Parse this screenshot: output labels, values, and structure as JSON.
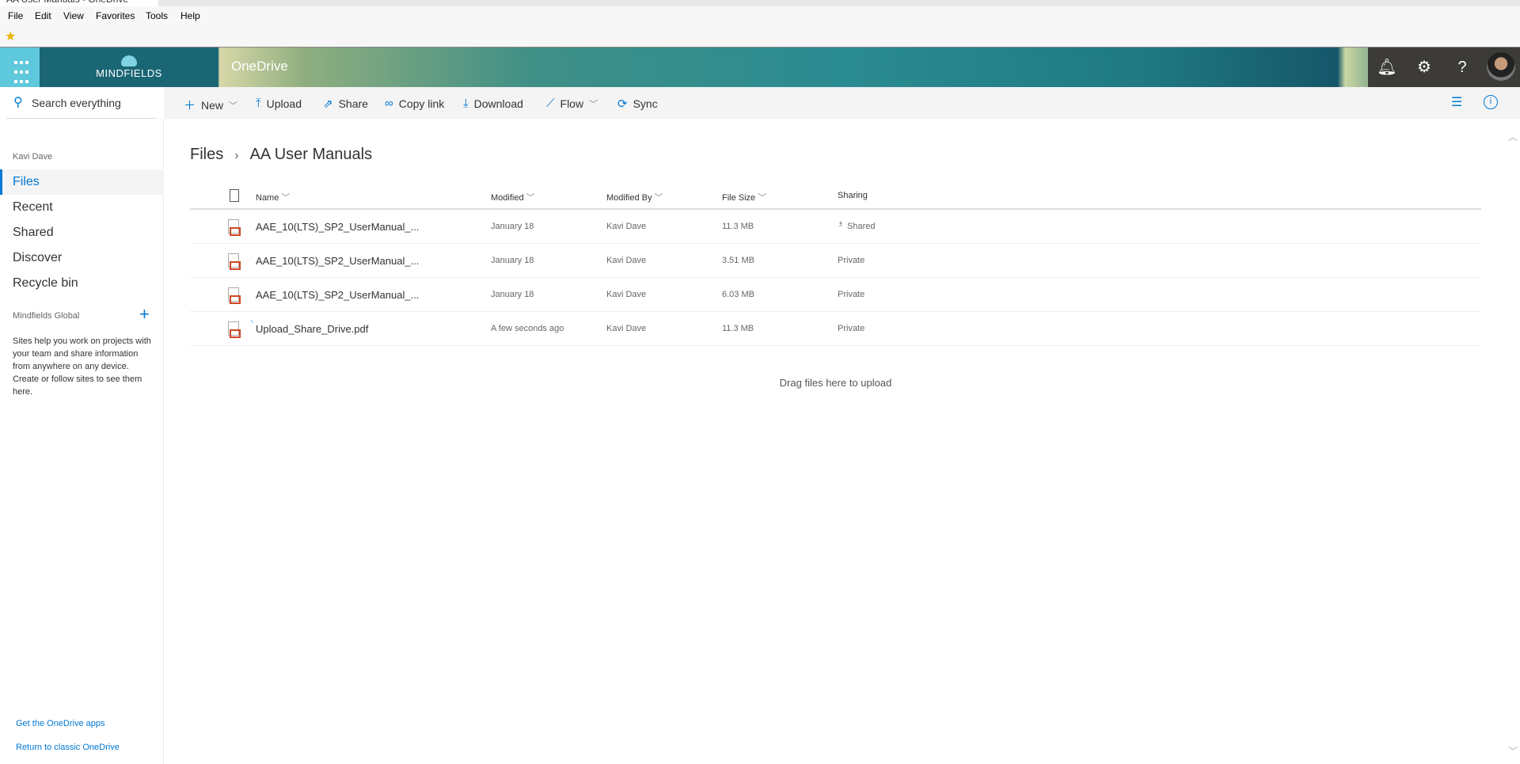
{
  "browser": {
    "tab_title": "AA User Manuals - OneDrive",
    "menu": [
      "File",
      "Edit",
      "View",
      "Favorites",
      "Tools",
      "Help"
    ]
  },
  "header": {
    "logo_text": "MINDFIELDS",
    "app_name": "OneDrive"
  },
  "search": {
    "placeholder": "Search everything"
  },
  "commands": {
    "new": "New",
    "upload": "Upload",
    "share": "Share",
    "copy_link": "Copy link",
    "download": "Download",
    "flow": "Flow",
    "sync": "Sync"
  },
  "nav": {
    "user": "Kavi Dave",
    "items": [
      "Files",
      "Recent",
      "Shared",
      "Discover",
      "Recycle bin"
    ],
    "sites_header": "Mindfields Global",
    "sites_text": "Sites help you work on projects with your team and share information from anywhere on any device. Create or follow sites to see them here.",
    "get_apps": "Get the OneDrive apps",
    "classic": "Return to classic OneDrive"
  },
  "breadcrumb": {
    "root": "Files",
    "current": "AA User Manuals"
  },
  "columns": {
    "name": "Name",
    "modified": "Modified",
    "modified_by": "Modified By",
    "file_size": "File Size",
    "sharing": "Sharing"
  },
  "files": [
    {
      "name": "AAE_10(LTS)_SP2_UserManual_...",
      "modified": "January 18",
      "modified_by": "Kavi Dave",
      "size": "11.3 MB",
      "sharing": "Shared"
    },
    {
      "name": "AAE_10(LTS)_SP2_UserManual_...",
      "modified": "January 18",
      "modified_by": "Kavi Dave",
      "size": "3.51 MB",
      "sharing": "Private"
    },
    {
      "name": "AAE_10(LTS)_SP2_UserManual_...",
      "modified": "January 18",
      "modified_by": "Kavi Dave",
      "size": "6.03 MB",
      "sharing": "Private"
    },
    {
      "name": "Upload_Share_Drive.pdf",
      "modified": "A few seconds ago",
      "modified_by": "Kavi Dave",
      "size": "11.3 MB",
      "sharing": "Private"
    }
  ],
  "drop_hint": "Drag files here to upload"
}
